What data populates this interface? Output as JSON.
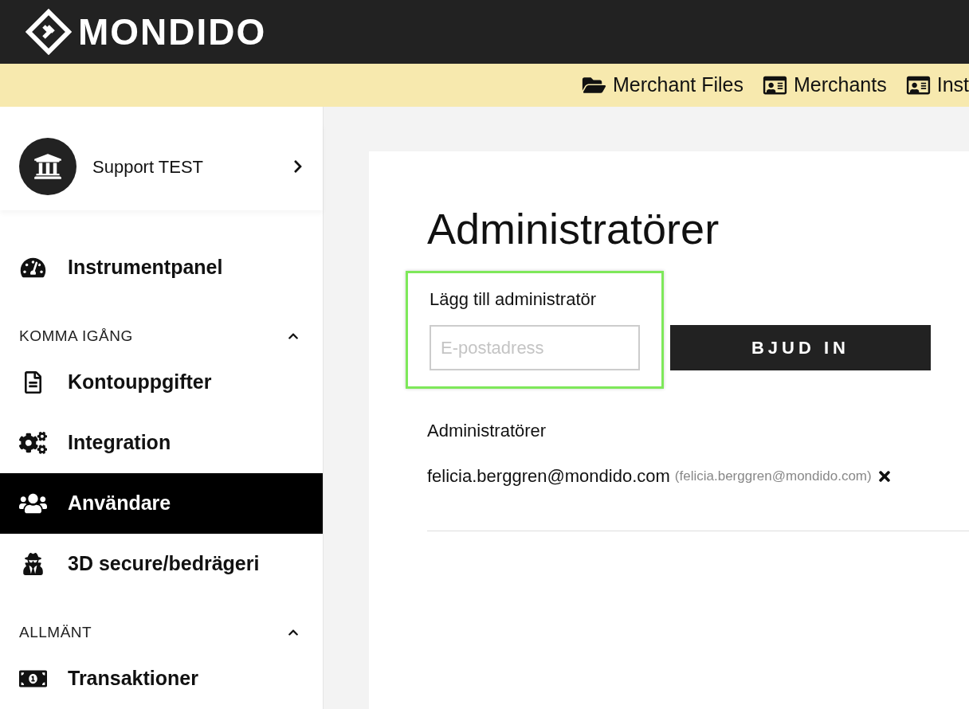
{
  "brand": {
    "name": "MONDIDO"
  },
  "top_links": [
    {
      "label": "Merchant Files"
    },
    {
      "label": "Merchants"
    },
    {
      "label": "Inst"
    }
  ],
  "account": {
    "name": "Support TEST"
  },
  "sidebar": {
    "top_items": [
      {
        "label": "Instrumentpanel",
        "selected": false
      }
    ],
    "sections": [
      {
        "title": "KOMMA IGÅNG",
        "expanded": true,
        "items": [
          {
            "label": "Kontouppgifter",
            "selected": false
          },
          {
            "label": "Integration",
            "selected": false
          },
          {
            "label": "Användare",
            "selected": true
          },
          {
            "label": "3D secure/bedrägeri",
            "selected": false
          }
        ]
      },
      {
        "title": "ALLMÄNT",
        "expanded": true,
        "items": [
          {
            "label": "Transaktioner",
            "selected": false
          }
        ]
      }
    ]
  },
  "page": {
    "title": "Administratörer",
    "invite": {
      "label": "Lägg till administratör",
      "placeholder": "E-postadress",
      "button": "BJUD IN",
      "highlighted": true
    },
    "list_title": "Administratörer",
    "admins": [
      {
        "name": "felicia.berggren@mondido.com",
        "email": "(felicia.berggren@mondido.com)"
      }
    ]
  }
}
